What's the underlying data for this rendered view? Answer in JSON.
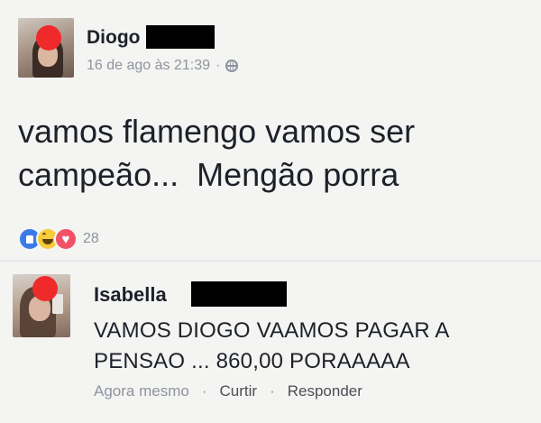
{
  "post": {
    "author": "Diogo",
    "timestamp": "16 de ago às 21:39",
    "separator": "·",
    "privacy_icon": "globe-icon",
    "text": "vamos flamengo vamos ser\ncampeão...  Mengão porra",
    "reactions": {
      "icons": [
        "like-icon",
        "haha-icon",
        "love-icon"
      ],
      "count": "28"
    }
  },
  "comment": {
    "author": "Isabella",
    "text": "VAMOS DIOGO VAAMOS PAGAR A\nPENSAO ... 860,00 PORAAAAA",
    "time": "Agora mesmo",
    "separator": "·",
    "like_label": "Curtir",
    "reply_label": "Responder"
  },
  "colors": {
    "redaction": "#000000",
    "avatar_mark": "#f02a2a",
    "like": "#3b7be8",
    "haha": "#f6cc3a",
    "love": "#f25268",
    "meta_text": "#8d949e"
  }
}
